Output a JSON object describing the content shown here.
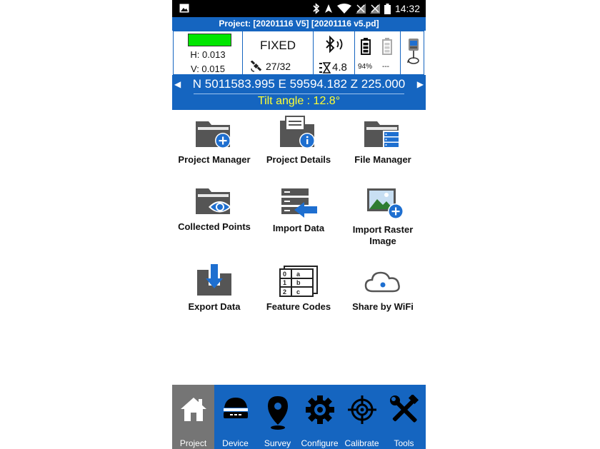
{
  "status_bar": {
    "time": "14:32",
    "icons": [
      "gallery-icon",
      "bluetooth-icon",
      "location-icon",
      "wifi-icon",
      "signal-icon",
      "signal-icon",
      "battery-icon"
    ]
  },
  "project_bar": {
    "title": "Project: [20201116 V5] [20201116 v5.pd]"
  },
  "info": {
    "h_label": "H: 0.013",
    "v_label": "V: 0.015",
    "fix_status": "FIXED",
    "satellites": "27/32",
    "age": "4.8",
    "battery1": "94%",
    "battery2": "---",
    "quality_color": "#00e600"
  },
  "coord_bar": {
    "coords": "N 5011583.995 E 59594.182 Z 225.000",
    "tilt": "Tilt angle : 12.8°",
    "tilt_color": "#ffff33"
  },
  "menu": [
    {
      "label": "Project Manager",
      "icon": "folder-add-icon"
    },
    {
      "label": "Project Details",
      "icon": "folder-info-icon"
    },
    {
      "label": "File Manager",
      "icon": "folder-list-icon"
    },
    {
      "label": "Collected Points",
      "icon": "folder-eye-icon"
    },
    {
      "label": "Import Data",
      "icon": "import-data-icon"
    },
    {
      "label": "Import Raster Image",
      "icon": "image-add-icon"
    },
    {
      "label": "Export Data",
      "icon": "folder-download-icon"
    },
    {
      "label": "Feature Codes",
      "icon": "feature-codes-icon"
    },
    {
      "label": "Share by WiFi",
      "icon": "cloud-icon"
    }
  ],
  "nav": [
    {
      "label": "Project",
      "icon": "home-icon",
      "active": true
    },
    {
      "label": "Device",
      "icon": "receiver-icon",
      "active": false
    },
    {
      "label": "Survey",
      "icon": "map-pin-icon",
      "active": false
    },
    {
      "label": "Configure",
      "icon": "gear-icon",
      "active": false
    },
    {
      "label": "Calibrate",
      "icon": "crosshair-icon",
      "active": false
    },
    {
      "label": "Tools",
      "icon": "tools-icon",
      "active": false
    }
  ],
  "colors": {
    "accent": "#1565c0",
    "nav_active": "#757575",
    "icon_dark": "#555555",
    "icon_blue": "#1e6fd0"
  }
}
